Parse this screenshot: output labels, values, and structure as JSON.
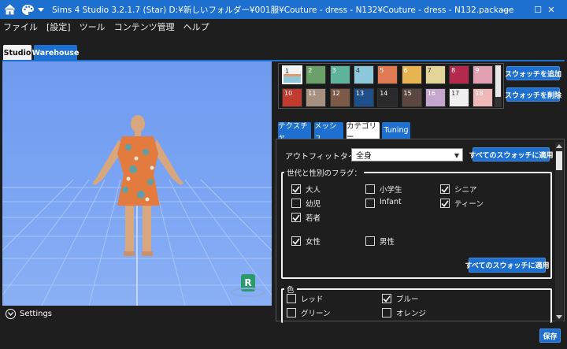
{
  "window": {
    "title": "Sims 4 Studio 3.2.1.7 (Star)  D:¥新しいフォルダー¥001服¥Couture - dress - N132¥Couture - dress - N132.package",
    "minimize": "—",
    "maximize": "☐",
    "close": "✕"
  },
  "menu": [
    "ファイル",
    "[設定]",
    "ツール",
    "コンテンツ管理",
    "ヘルプ"
  ],
  "main_tabs": [
    "Studio",
    "Warehouse"
  ],
  "viewport": {
    "settings_label": "Settings",
    "badge_letter": "R"
  },
  "swatches": [
    {
      "n": "1",
      "color": "#f2f2f2"
    },
    {
      "n": "2",
      "color": "#6ba06b"
    },
    {
      "n": "3",
      "color": "#5fb49a"
    },
    {
      "n": "4",
      "color": "#8ec8dc"
    },
    {
      "n": "5",
      "color": "#e07a52"
    },
    {
      "n": "6",
      "color": "#e8b552"
    },
    {
      "n": "7",
      "color": "#e3d49a"
    },
    {
      "n": "8",
      "color": "#b5294e"
    },
    {
      "n": "9",
      "color": "#e0a0b2"
    },
    {
      "n": "10",
      "color": "#c33b2e"
    },
    {
      "n": "11",
      "color": "#a69181"
    },
    {
      "n": "12",
      "color": "#7d5a48"
    },
    {
      "n": "13",
      "color": "#1f4f8a"
    },
    {
      "n": "14",
      "color": "#2a2a2a"
    },
    {
      "n": "15",
      "color": "#5c4640"
    },
    {
      "n": "16",
      "color": "#c4a6cf"
    },
    {
      "n": "17",
      "color": "#efefef"
    },
    {
      "n": "18",
      "color": "#f0b8b8"
    }
  ],
  "swatch_buttons": {
    "add": "スウォッチを追加",
    "delete": "スウォッチを削除"
  },
  "sub_tabs": [
    "テクスチャ",
    "メッシュ",
    "カテゴリー",
    "Tuning"
  ],
  "outfit": {
    "label": "アウトフィットタイプ：",
    "value": "全身",
    "apply": "すべてのスウォッチに適用"
  },
  "age_gender": {
    "title": "世代と性別のフラグ：",
    "items": [
      {
        "label": "大人",
        "checked": true
      },
      {
        "label": "小学生",
        "checked": false
      },
      {
        "label": "シニア",
        "checked": true
      },
      {
        "label": "幼児",
        "checked": false
      },
      {
        "label": "Infant",
        "checked": false
      },
      {
        "label": "ティーン",
        "checked": true
      },
      {
        "label": "若者",
        "checked": true
      },
      {
        "label": "女性",
        "checked": true
      },
      {
        "label": "男性",
        "checked": false
      }
    ],
    "apply": "すべてのスウォッチに適用"
  },
  "color_group": {
    "title": "色",
    "items": [
      {
        "label": "レッド",
        "checked": false
      },
      {
        "label": "ブルー",
        "checked": true
      },
      {
        "label": "グリーン",
        "checked": false
      },
      {
        "label": "オレンジ",
        "checked": false
      }
    ]
  },
  "save": "保存"
}
